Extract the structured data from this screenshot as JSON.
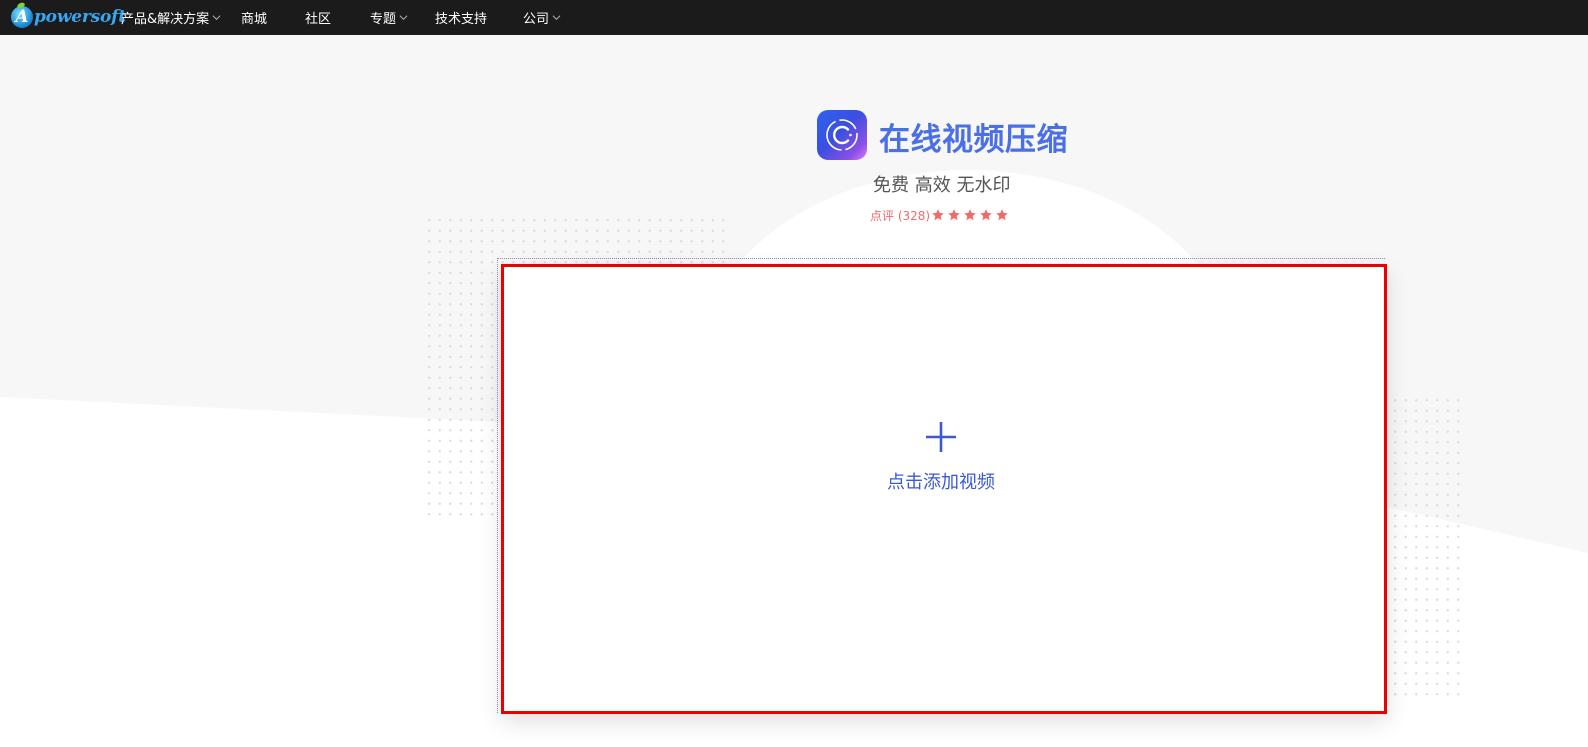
{
  "brand": {
    "badge_letter": "A",
    "text": "powersoft"
  },
  "nav": [
    {
      "label": "产品&解决方案",
      "has_dropdown": true
    },
    {
      "label": "商城",
      "has_dropdown": false
    },
    {
      "label": "社区",
      "has_dropdown": false
    },
    {
      "label": "专题",
      "has_dropdown": true
    },
    {
      "label": "技术支持",
      "has_dropdown": false
    },
    {
      "label": "公司",
      "has_dropdown": true
    }
  ],
  "header": {
    "title": "在线视频压缩",
    "subtitle": "免费 高效 无水印",
    "rating_label": "点评 (328)",
    "stars": 5
  },
  "upload": {
    "label": "点击添加视频",
    "icon": "plus-icon"
  },
  "colors": {
    "topbar": "#1b1b1b",
    "title": "#4a6fe6",
    "accent": "#3a58d8",
    "star": "#f06a6a",
    "highlight_border": "#ee0000"
  }
}
